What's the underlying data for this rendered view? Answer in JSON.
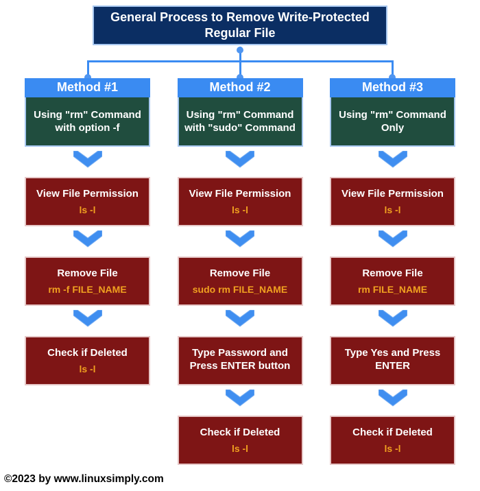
{
  "title": "General Process to Remove Write-Protected Regular File",
  "methods": [
    {
      "header": "Method #1",
      "subheader": "Using \"rm\" Command with option -f",
      "steps": [
        {
          "label": "View File Permission",
          "cmd": "ls -l"
        },
        {
          "label": "Remove File",
          "cmd": "rm -f FILE_NAME"
        },
        {
          "label": "Check if Deleted",
          "cmd": "ls -l"
        }
      ]
    },
    {
      "header": "Method #2",
      "subheader": "Using \"rm\" Command with \"sudo\" Command",
      "steps": [
        {
          "label": "View File Permission",
          "cmd": "ls -l"
        },
        {
          "label": "Remove File",
          "cmd": "sudo rm FILE_NAME"
        },
        {
          "label": "Type Password and Press ENTER button",
          "cmd": ""
        },
        {
          "label": "Check if Deleted",
          "cmd": "ls -l"
        }
      ]
    },
    {
      "header": "Method #3",
      "subheader": "Using \"rm\" Command Only",
      "steps": [
        {
          "label": "View File Permission",
          "cmd": "ls -l"
        },
        {
          "label": "Remove File",
          "cmd": "rm FILE_NAME"
        },
        {
          "label": "Type Yes and Press ENTER",
          "cmd": ""
        },
        {
          "label": "Check if Deleted",
          "cmd": "ls -l"
        }
      ]
    }
  ],
  "copyright": "©2023 by www.linuxsimply.com"
}
